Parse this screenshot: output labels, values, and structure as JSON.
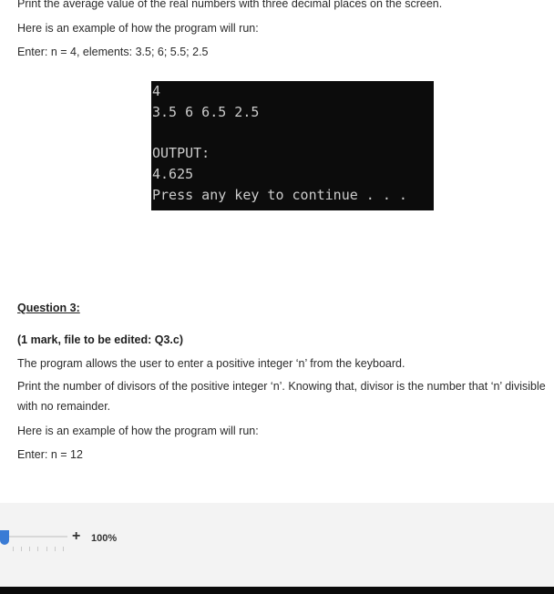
{
  "document": {
    "line_top": "Print the average value of the real numbers with three decimal places on the screen.",
    "example_intro": "Here is an example of how the program will run:",
    "example_enter": "Enter: n = 4, elements: 3.5;  6;  5.5;  2.5",
    "question_heading": "Question 3:",
    "mark_info": "(1 mark, file to be edited: Q3.c)",
    "description_1": "The program allows the user to enter a positive integer ‘n’ from the keyboard.",
    "description_2": "Print the number of divisors of the positive integer ‘n’. Knowing that, divisor is the number that ‘n’ divisible with no remainder.",
    "example_intro_2": "Here is an example of how the program will run:",
    "example_enter_2": "Enter: n = 12"
  },
  "console": {
    "lines": [
      "4",
      "3.5 6 6.5 2.5",
      "",
      "OUTPUT:",
      "4.625",
      "Press any key to continue . . ."
    ]
  },
  "zoom_bar": {
    "plus_label": "+",
    "zoom_level": "100%",
    "slider_value_percent": 0
  }
}
